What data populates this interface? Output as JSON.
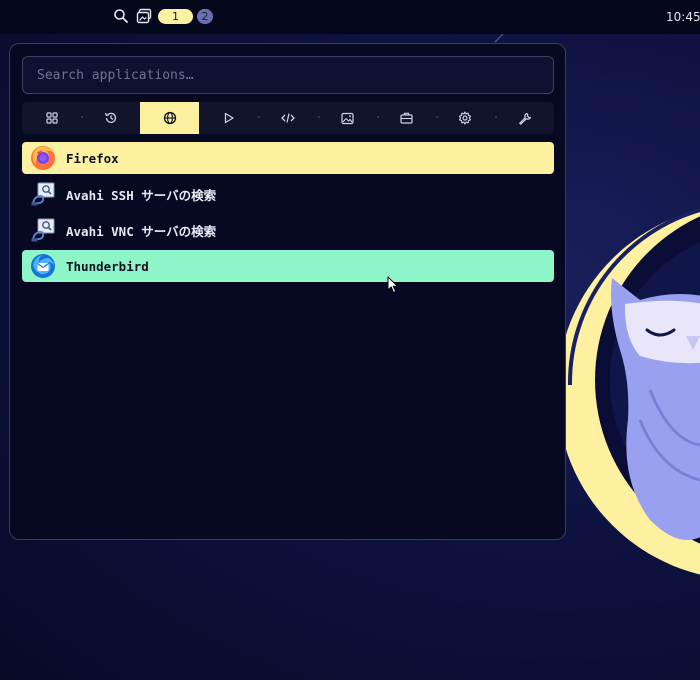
{
  "topbar": {
    "icons": {
      "search": "search-icon",
      "overview": "overview-icon"
    },
    "workspaces": [
      {
        "label": "1",
        "active": true
      },
      {
        "label": "2",
        "active": false
      }
    ],
    "clock": "10:45"
  },
  "launcher": {
    "search_placeholder": "Search applications…",
    "search_value": "",
    "categories": [
      {
        "name": "all-apps",
        "icon": "grid-icon"
      },
      {
        "name": "recent",
        "icon": "history-icon"
      },
      {
        "name": "internet",
        "icon": "globe-icon",
        "active": true
      },
      {
        "name": "multimedia",
        "icon": "play-icon"
      },
      {
        "name": "development",
        "icon": "code-icon"
      },
      {
        "name": "graphics",
        "icon": "image-icon"
      },
      {
        "name": "office",
        "icon": "briefcase-icon"
      },
      {
        "name": "settings",
        "icon": "gear-icon"
      },
      {
        "name": "utilities",
        "icon": "wrench-icon"
      }
    ],
    "apps": [
      {
        "label": "Firefox",
        "icon": "firefox-icon",
        "state": "selected"
      },
      {
        "label": "Avahi SSH サーバの検索",
        "icon": "avahi-ssh-icon",
        "state": "normal"
      },
      {
        "label": "Avahi VNC サーバの検索",
        "icon": "avahi-vnc-icon",
        "state": "normal"
      },
      {
        "label": "Thunderbird",
        "icon": "thunderbird-icon",
        "state": "hovered"
      }
    ]
  },
  "colors": {
    "accent_yellow": "#fdf0a0",
    "accent_mint": "#8ef5c8",
    "panel_bg": "#070822",
    "wallpaper_bg": "#0e1240",
    "owl_body": "#9aa0f0",
    "moon": "#fdf0a0"
  }
}
